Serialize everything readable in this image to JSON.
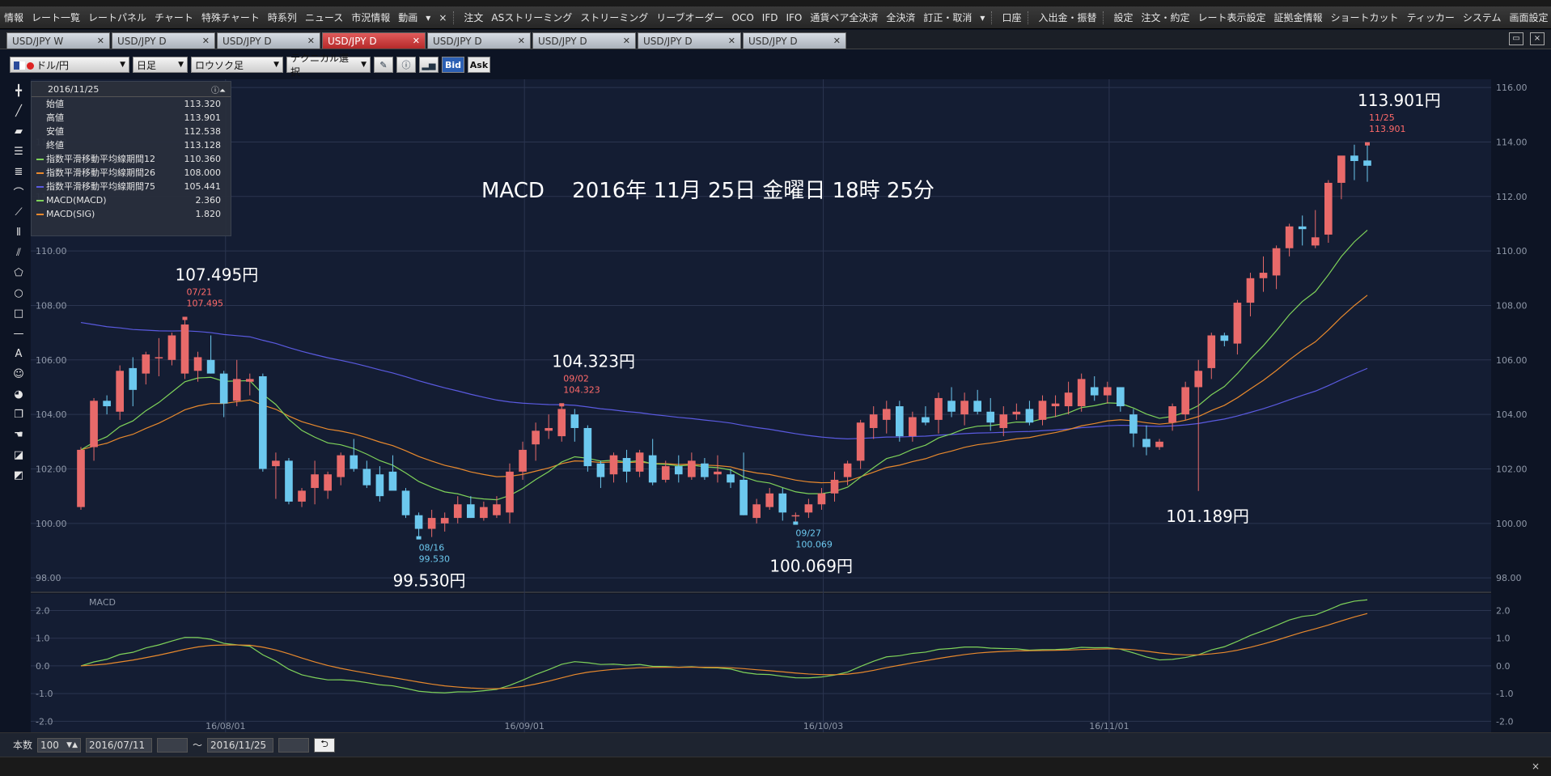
{
  "menu": {
    "items": [
      {
        "label": "情報",
        "accent": ""
      },
      {
        "label": "レート一覧"
      },
      {
        "label": "レートパネル"
      },
      {
        "label": "チャート"
      },
      {
        "label": "特殊チャート"
      },
      {
        "label": "時系列"
      },
      {
        "label": "ニュース"
      },
      {
        "label": "市況情報"
      },
      {
        "label": "動画"
      },
      {
        "label": "▾"
      },
      {
        "label": "×"
      },
      {
        "label": "注文",
        "accent": "#8844cc"
      },
      {
        "label": "ASストリーミング"
      },
      {
        "label": "ストリーミング"
      },
      {
        "label": "リーブオーダー"
      },
      {
        "label": "OCO"
      },
      {
        "label": "IFD"
      },
      {
        "label": "IFO"
      },
      {
        "label": "通貨ペア全決済"
      },
      {
        "label": "全決済"
      },
      {
        "label": "訂正・取消"
      },
      {
        "label": "▾"
      },
      {
        "label": "口座",
        "accent": "#e07a20"
      },
      {
        "label": "入出金・振替",
        "accent": "#33bb44"
      },
      {
        "label": "設定",
        "accent": "#cc3333"
      },
      {
        "label": "注文・約定"
      },
      {
        "label": "レート表示設定"
      },
      {
        "label": "証拠金情報"
      },
      {
        "label": "ショートカット"
      },
      {
        "label": "ティッカー"
      },
      {
        "label": "システム"
      },
      {
        "label": "画面設定"
      },
      {
        "label": "チャート"
      }
    ]
  },
  "tabs": [
    {
      "label": "USD/JPY W",
      "active": false
    },
    {
      "label": "USD/JPY D",
      "active": false
    },
    {
      "label": "USD/JPY D",
      "active": false
    },
    {
      "label": "USD/JPY D",
      "active": true
    },
    {
      "label": "USD/JPY D",
      "active": false
    },
    {
      "label": "USD/JPY D",
      "active": false
    },
    {
      "label": "USD/JPY D",
      "active": false
    },
    {
      "label": "USD/JPY D",
      "active": false
    }
  ],
  "toolbar": {
    "pair": "ドル/円",
    "period": "日足",
    "chart_style": "ロウソク足",
    "technical": "テクニカル選択",
    "bid": "Bid",
    "ask": "Ask"
  },
  "infobox": {
    "date": "2016/11/25",
    "rows": [
      {
        "label": "始値",
        "value": "113.320",
        "color": ""
      },
      {
        "label": "高値",
        "value": "113.901",
        "color": ""
      },
      {
        "label": "安値",
        "value": "112.538",
        "color": ""
      },
      {
        "label": "終値",
        "value": "113.128",
        "color": ""
      },
      {
        "label": "指数平滑移動平均線期間12",
        "value": "110.360",
        "color": "#7fd35a"
      },
      {
        "label": "指数平滑移動平均線期間26",
        "value": "108.000",
        "color": "#e8892d"
      },
      {
        "label": "指数平滑移動平均線期間75",
        "value": "105.441",
        "color": "#5a5ae0"
      },
      {
        "label": "MACD(MACD)",
        "value": "2.360",
        "color": "#7fd35a"
      },
      {
        "label": "MACD(SIG)",
        "value": "1.820",
        "color": "#e8892d"
      }
    ]
  },
  "bottombar": {
    "count_label": "本数",
    "count_value": "100",
    "from_date": "2016/07/11",
    "tilde": "〜",
    "to_date": "2016/11/25"
  },
  "chart_data": {
    "type": "candlestick",
    "title": "MACD　 2016年 11月 25日 金曜日 18時 25分",
    "colors": {
      "up": "#e86a6a",
      "down": "#6cc8ee",
      "ema12": "#7fd35a",
      "ema26": "#e8892d",
      "ema75": "#5a5ae0"
    },
    "price_axis": {
      "ylim": [
        97.5,
        116.3
      ],
      "ticks": [
        "116.00",
        "114.00",
        "112.00",
        "110.00",
        "108.00",
        "106.00",
        "104.00",
        "102.00",
        "100.00",
        "98.00"
      ]
    },
    "macd_axis": {
      "label": "MACD",
      "ylim": [
        -2.4,
        2.6
      ],
      "ticks": [
        "2.0",
        "1.0",
        "0.0",
        "-1.0",
        "-2.0"
      ]
    },
    "x_ticks": [
      {
        "label": "16/08/01",
        "index": 13
      },
      {
        "label": "16/09/01",
        "index": 36
      },
      {
        "label": "16/10/03",
        "index": 59
      },
      {
        "label": "16/11/01",
        "index": 81
      }
    ],
    "candles": [
      [
        100.6,
        102.8,
        100.5,
        102.7
      ],
      [
        102.8,
        104.6,
        102.3,
        104.5
      ],
      [
        104.5,
        104.7,
        104.0,
        104.3
      ],
      [
        104.1,
        105.8,
        103.8,
        105.6
      ],
      [
        105.7,
        106.1,
        104.3,
        104.9
      ],
      [
        105.5,
        106.3,
        105.1,
        106.2
      ],
      [
        106.1,
        106.8,
        105.4,
        106.1
      ],
      [
        106.0,
        107.0,
        105.8,
        106.9
      ],
      [
        105.5,
        107.495,
        105.3,
        107.3
      ],
      [
        105.6,
        106.3,
        105.2,
        106.1
      ],
      [
        106.0,
        106.9,
        105.5,
        105.5
      ],
      [
        105.5,
        105.6,
        103.9,
        104.4
      ],
      [
        104.5,
        106.0,
        104.3,
        105.3
      ],
      [
        105.2,
        105.5,
        104.7,
        105.3
      ],
      [
        105.4,
        105.5,
        101.9,
        102.0
      ],
      [
        102.1,
        102.6,
        100.9,
        102.3
      ],
      [
        102.3,
        102.4,
        100.7,
        100.8
      ],
      [
        100.8,
        101.3,
        100.6,
        101.2
      ],
      [
        101.3,
        102.3,
        100.7,
        101.8
      ],
      [
        101.2,
        101.9,
        100.9,
        101.8
      ],
      [
        101.7,
        102.6,
        101.4,
        102.5
      ],
      [
        102.5,
        103.1,
        101.9,
        102.0
      ],
      [
        102.0,
        102.3,
        101.3,
        101.4
      ],
      [
        101.8,
        102.1,
        100.8,
        101.0
      ],
      [
        101.9,
        102.5,
        101.5,
        101.2
      ],
      [
        101.2,
        101.3,
        100.2,
        100.3
      ],
      [
        100.3,
        100.4,
        99.53,
        99.8
      ],
      [
        99.8,
        100.5,
        99.5,
        100.2
      ],
      [
        100.0,
        100.4,
        99.7,
        100.2
      ],
      [
        100.2,
        101.0,
        100.0,
        100.7
      ],
      [
        100.7,
        101.0,
        100.2,
        100.2
      ],
      [
        100.2,
        100.8,
        100.1,
        100.6
      ],
      [
        100.3,
        101.0,
        100.2,
        100.7
      ],
      [
        100.4,
        102.2,
        100.0,
        101.9
      ],
      [
        101.9,
        103.0,
        101.6,
        102.7
      ],
      [
        102.9,
        103.7,
        102.3,
        103.4
      ],
      [
        103.4,
        104.0,
        103.1,
        103.5
      ],
      [
        103.2,
        104.323,
        103.0,
        104.2
      ],
      [
        104.0,
        104.2,
        103.0,
        103.5
      ],
      [
        103.5,
        103.6,
        101.9,
        102.1
      ],
      [
        102.2,
        102.3,
        101.3,
        101.7
      ],
      [
        101.8,
        102.6,
        101.5,
        102.5
      ],
      [
        102.4,
        102.7,
        101.5,
        101.9
      ],
      [
        101.9,
        102.7,
        101.7,
        102.6
      ],
      [
        102.5,
        103.1,
        101.4,
        101.5
      ],
      [
        101.6,
        102.3,
        101.5,
        102.1
      ],
      [
        102.1,
        102.5,
        101.5,
        101.8
      ],
      [
        101.7,
        102.6,
        101.6,
        102.3
      ],
      [
        102.2,
        102.4,
        101.6,
        101.7
      ],
      [
        101.8,
        102.5,
        101.5,
        101.9
      ],
      [
        101.8,
        102.0,
        101.3,
        101.5
      ],
      [
        101.6,
        102.6,
        100.3,
        100.3
      ],
      [
        100.2,
        100.9,
        100.0,
        100.7
      ],
      [
        100.6,
        101.3,
        100.5,
        101.1
      ],
      [
        101.1,
        101.3,
        100.1,
        100.4
      ],
      [
        100.3,
        100.4,
        100.069,
        100.3
      ],
      [
        100.4,
        100.9,
        100.2,
        100.7
      ],
      [
        100.7,
        101.3,
        100.5,
        101.1
      ],
      [
        101.1,
        101.9,
        100.8,
        101.6
      ],
      [
        101.7,
        102.3,
        101.4,
        102.2
      ],
      [
        102.3,
        103.8,
        102.0,
        103.7
      ],
      [
        103.5,
        104.3,
        103.1,
        104.0
      ],
      [
        103.8,
        104.5,
        103.3,
        104.2
      ],
      [
        104.3,
        104.5,
        103.0,
        103.2
      ],
      [
        103.2,
        104.1,
        103.0,
        103.9
      ],
      [
        103.9,
        104.3,
        103.6,
        103.7
      ],
      [
        103.8,
        104.8,
        103.3,
        104.6
      ],
      [
        104.5,
        105.0,
        103.9,
        104.1
      ],
      [
        104.0,
        104.8,
        103.6,
        104.5
      ],
      [
        104.5,
        104.9,
        104.0,
        104.1
      ],
      [
        104.1,
        104.6,
        103.4,
        103.7
      ],
      [
        103.5,
        104.3,
        103.2,
        104.0
      ],
      [
        104.0,
        104.4,
        103.8,
        104.1
      ],
      [
        104.2,
        104.5,
        103.6,
        103.7
      ],
      [
        103.8,
        104.7,
        103.6,
        104.5
      ],
      [
        104.3,
        104.7,
        103.9,
        104.4
      ],
      [
        104.3,
        105.2,
        104.0,
        104.8
      ],
      [
        104.3,
        105.5,
        104.1,
        105.3
      ],
      [
        105.0,
        105.4,
        104.5,
        104.7
      ],
      [
        104.7,
        105.2,
        104.4,
        105.0
      ],
      [
        105.0,
        105.0,
        104.1,
        104.3
      ],
      [
        104.0,
        104.2,
        102.8,
        103.3
      ],
      [
        103.1,
        103.6,
        102.5,
        102.8
      ],
      [
        102.8,
        103.1,
        102.7,
        103.0
      ],
      [
        103.7,
        104.4,
        103.4,
        104.3
      ],
      [
        104.0,
        105.2,
        103.8,
        105.0
      ],
      [
        105.0,
        106.0,
        101.189,
        105.6
      ],
      [
        105.7,
        107.0,
        105.3,
        106.9
      ],
      [
        106.9,
        107.0,
        106.5,
        106.7
      ],
      [
        106.6,
        108.2,
        106.2,
        108.1
      ],
      [
        108.1,
        109.2,
        107.6,
        109.0
      ],
      [
        109.0,
        109.8,
        108.5,
        109.2
      ],
      [
        109.1,
        110.2,
        108.6,
        110.1
      ],
      [
        110.1,
        111.0,
        109.8,
        110.9
      ],
      [
        110.9,
        111.3,
        110.2,
        110.8
      ],
      [
        110.2,
        111.5,
        110.1,
        110.5
      ],
      [
        110.6,
        112.6,
        110.3,
        112.5
      ],
      [
        112.5,
        113.4,
        111.9,
        113.5
      ],
      [
        113.5,
        113.9,
        112.6,
        113.3
      ],
      [
        113.32,
        113.901,
        112.538,
        113.128
      ]
    ],
    "annotations": [
      {
        "text": "107.495円",
        "date": "07/21",
        "price": "107.495",
        "index": 8,
        "kind": "high"
      },
      {
        "text": "99.530円",
        "date": "08/16",
        "price": "99.530",
        "index": 26,
        "kind": "low"
      },
      {
        "text": "104.323円",
        "date": "09/02",
        "price": "104.323",
        "index": 37,
        "kind": "high"
      },
      {
        "text": "100.069円",
        "date": "09/27",
        "price": "100.069",
        "index": 55,
        "kind": "low"
      },
      {
        "text": "101.189円",
        "date": "",
        "price": "",
        "index": 86,
        "kind": "low-plain"
      },
      {
        "text": "113.901円",
        "date": "11/25",
        "price": "113.901",
        "index": 99,
        "kind": "high"
      }
    ]
  }
}
